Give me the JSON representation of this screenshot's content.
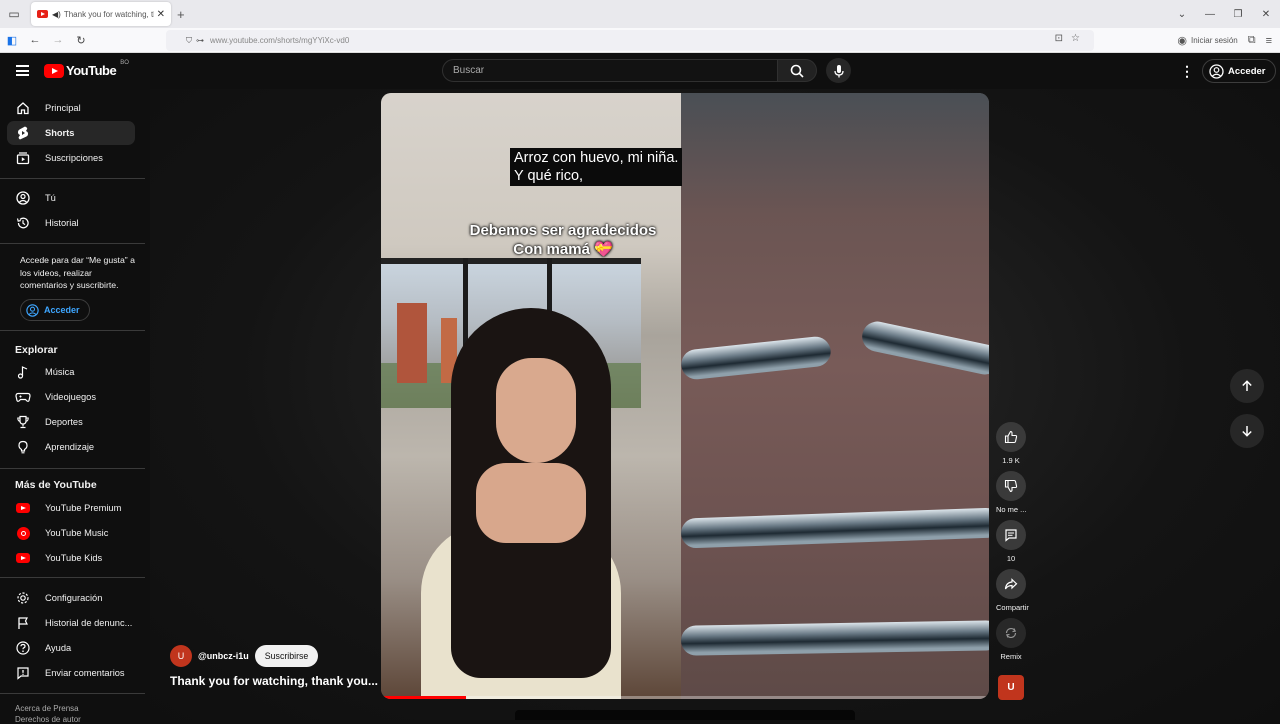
{
  "browser": {
    "tab_title": "Thank you for watching, thank y",
    "url": "www.youtube.com/shorts/mgYYiXc-vd0",
    "signin_label": "Iniciar sesión"
  },
  "header": {
    "logo_text": "YouTube",
    "country_code": "BO",
    "search_placeholder": "Buscar",
    "signin_label": "Acceder"
  },
  "sidebar": {
    "main": [
      {
        "label": "Principal",
        "icon": "home-icon"
      },
      {
        "label": "Shorts",
        "icon": "shorts-icon",
        "active": true
      },
      {
        "label": "Suscripciones",
        "icon": "subscriptions-icon"
      }
    ],
    "you": [
      {
        "label": "Tú",
        "icon": "user-icon"
      },
      {
        "label": "Historial",
        "icon": "history-icon"
      }
    ],
    "signin_note": "Accede para dar “Me gusta” a los videos, realizar comentarios y suscribirte.",
    "signin_button": "Acceder",
    "explore_title": "Explorar",
    "explore": [
      {
        "label": "Música",
        "icon": "music-note-icon"
      },
      {
        "label": "Videojuegos",
        "icon": "gamepad-icon"
      },
      {
        "label": "Deportes",
        "icon": "trophy-icon"
      },
      {
        "label": "Aprendizaje",
        "icon": "lightbulb-icon"
      }
    ],
    "more_title": "Más de YouTube",
    "more": [
      {
        "label": "YouTube Premium"
      },
      {
        "label": "YouTube Music"
      },
      {
        "label": "YouTube Kids"
      }
    ],
    "settings": [
      {
        "label": "Configuración",
        "icon": "gear-icon"
      },
      {
        "label": "Historial de denunc...",
        "icon": "flag-icon"
      },
      {
        "label": "Ayuda",
        "icon": "help-icon"
      },
      {
        "label": "Enviar comentarios",
        "icon": "feedback-icon"
      }
    ],
    "footer_line1": "Acerca de   Prensa",
    "footer_line2": "Derechos de autor"
  },
  "short": {
    "caption_line1": "Arroz con huevo, mi niña.",
    "caption_line2": "Y qué rico,",
    "overlay_line1": "Debemos ser agradecidos",
    "overlay_line2": "Con mamá 💝",
    "channel_initial": "U",
    "channel_name": "@unbcz-i1u",
    "subscribe_label": "Suscribirse",
    "title": "Thank you for watching, thank you...",
    "progress": 0.14
  },
  "actions": {
    "like_count": "1.9 K",
    "dislike_label": "No me ...",
    "comments_count": "10",
    "share_label": "Compartir",
    "remix_label": "Remix",
    "avatar_initial": "U"
  },
  "colors": {
    "brand_red": "#ff0000",
    "accent_blue": "#3ea6ff",
    "background": "#0f0f0f"
  }
}
